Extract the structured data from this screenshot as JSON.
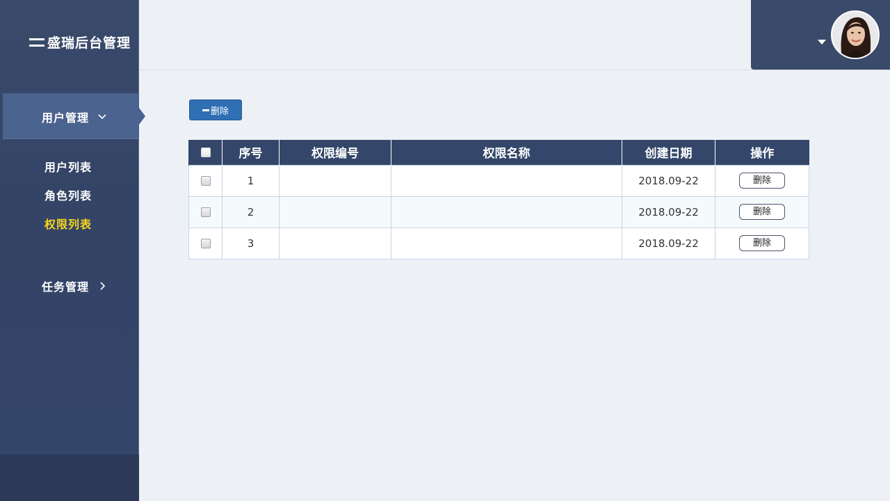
{
  "app": {
    "title": "盛瑞后台管理"
  },
  "sidebar": {
    "groups": [
      {
        "label": "用户管理",
        "expanded": true,
        "items": [
          {
            "label": "用户列表"
          },
          {
            "label": "角色列表"
          },
          {
            "label": "权限列表",
            "active": true
          }
        ]
      },
      {
        "label": "任务管理",
        "expanded": false
      }
    ]
  },
  "toolbar": {
    "delete_label": "删除"
  },
  "table": {
    "columns": [
      "序号",
      "权限编号",
      "权限名称",
      "创建日期",
      "操作"
    ],
    "rows": [
      {
        "index": "1",
        "code": "",
        "name": "",
        "date": "2018.09-22",
        "action": "删除"
      },
      {
        "index": "2",
        "code": "",
        "name": "",
        "date": "2018.09-22",
        "action": "删除"
      },
      {
        "index": "3",
        "code": "",
        "name": "",
        "date": "2018.09-22",
        "action": "删除"
      }
    ]
  },
  "colors": {
    "sidebar_bg": "#3a4a6b",
    "active_menu_bg": "#4b638f",
    "active_item": "#f5d51d",
    "table_header_bg": "#34476a",
    "primary_button": "#2f6fb3"
  },
  "icons": {
    "menu": "menu-icon",
    "expand": "chevron-down-icon",
    "collapse": "chevron-right-icon",
    "user_dropdown": "caret-down-icon"
  }
}
